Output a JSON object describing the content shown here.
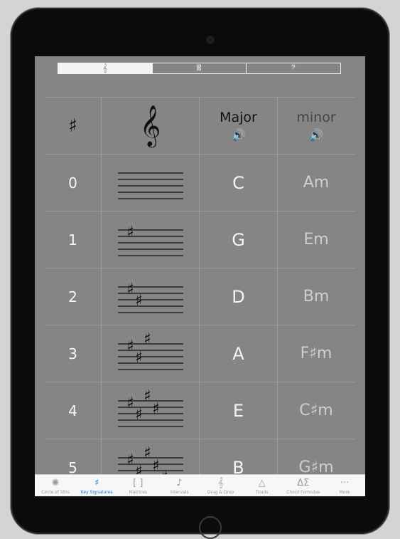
{
  "segmented": {
    "items": [
      {
        "label": "𝄞",
        "name": "treble-clef-segment",
        "active": true
      },
      {
        "label": "𝄡",
        "name": "alto-clef-segment",
        "active": false
      },
      {
        "label": "𝄢",
        "name": "bass-clef-segment",
        "active": false
      }
    ]
  },
  "header": {
    "sharp": "♯",
    "clef": "𝄞",
    "major": "Major",
    "minor": "minor",
    "speaker": "🔊"
  },
  "rows": [
    {
      "count": "0",
      "sharps": 0,
      "major": "C",
      "minor": "Am"
    },
    {
      "count": "1",
      "sharps": 1,
      "major": "G",
      "minor": "Em"
    },
    {
      "count": "2",
      "sharps": 2,
      "major": "D",
      "minor": "Bm"
    },
    {
      "count": "3",
      "sharps": 3,
      "major": "A",
      "minor": "F♯m"
    },
    {
      "count": "4",
      "sharps": 4,
      "major": "E",
      "minor": "C♯m"
    },
    {
      "count": "5",
      "sharps": 5,
      "major": "B",
      "minor": "G♯m"
    }
  ],
  "tabbar": [
    {
      "label": "Circle of 5ths",
      "icon": "circle-of-fifths-icon",
      "glyph": "✺",
      "active": false
    },
    {
      "label": "Key Signatures",
      "icon": "sharp-icon",
      "glyph": "♯",
      "active": true
    },
    {
      "label": "Matrices",
      "icon": "brackets-icon",
      "glyph": "[ ]",
      "active": false
    },
    {
      "label": "Intervals",
      "icon": "note-icon",
      "glyph": "♪",
      "active": false
    },
    {
      "label": "Drag & Drop",
      "icon": "drag-drop-icon",
      "glyph": "𝄞",
      "active": false
    },
    {
      "label": "Triads",
      "icon": "triangle-icon",
      "glyph": "△",
      "active": false
    },
    {
      "label": "Chord Formulas",
      "icon": "formula-icon",
      "glyph": "ΔΣ",
      "active": false
    },
    {
      "label": "More",
      "icon": "more-icon",
      "glyph": "···",
      "active": false
    }
  ]
}
